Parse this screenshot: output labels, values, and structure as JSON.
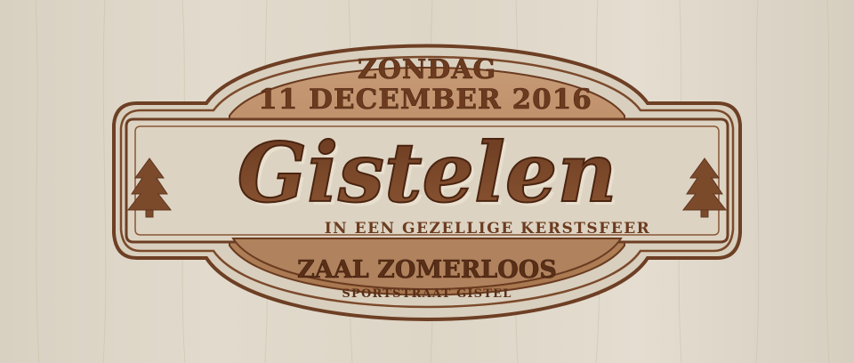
{
  "event": {
    "day": "ZONDAG",
    "date": "11 DECEMBER 2016",
    "title": "Gistelen",
    "tagline": "IN EEN GEZELLIGE KERSTSFEER",
    "venue": "ZAAL ZOMERLOOS",
    "address": "SPORTSTRAAT GISTEL"
  },
  "icons": {
    "left": "pine-tree-icon",
    "right": "pine-tree-icon"
  },
  "colors": {
    "wood": "#ded7c9",
    "engrave": "#7b4a2b",
    "engrave_dark": "#5f3520",
    "engrave_light": "#a67552",
    "plate": "#b58a67"
  }
}
